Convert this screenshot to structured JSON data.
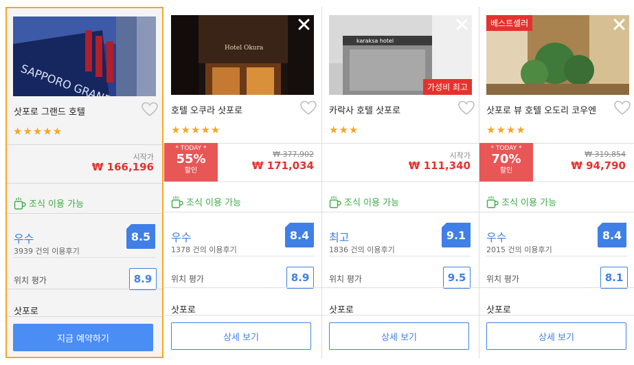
{
  "colors": {
    "accent": "#3f7fe6",
    "price": "#e5322d",
    "discount_bg": "#e85656",
    "breakfast": "#3cab46",
    "star": "#f5a623",
    "selected_border": "#f5a623"
  },
  "hotels": [
    {
      "name": "삿포로 그랜드 호텔",
      "stars": "★★★★★",
      "price_from_label": "시작가",
      "price": "₩ 166,196",
      "breakfast": "조식 이용 가능",
      "rating_word": "우수",
      "reviews": "3939 건의 이용후기",
      "score": "8.5",
      "location_label": "위치 평가",
      "location_score": "8.9",
      "city": "삿포로",
      "button": "지금 예약하기"
    },
    {
      "name": "호텔 오쿠라 삿포로",
      "stars": "★★★★★",
      "discount_today": "* TODAY *",
      "discount_pct": "55%",
      "discount_label": "할인",
      "original_price": "₩ 377,902",
      "price": "₩ 171,034",
      "breakfast": "조식 이용 가능",
      "rating_word": "우수",
      "reviews": "1378 건의 이용후기",
      "score": "8.4",
      "location_label": "위치 평가",
      "location_score": "8.9",
      "city": "삿포로",
      "button": "상세 보기"
    },
    {
      "name": "카락사 호텔 삿포로",
      "stars": "★★★",
      "badge": "가성비 최고",
      "price_from_label": "시작가",
      "price": "₩ 111,340",
      "breakfast": "조식 이용 가능",
      "rating_word": "최고",
      "reviews": "1836 건의 이용후기",
      "score": "9.1",
      "location_label": "위치 평가",
      "location_score": "9.5",
      "city": "삿포로",
      "button": "상세 보기"
    },
    {
      "name": "삿포로 뷰 호텔 오도리 코우엔",
      "stars": "★★★★",
      "badge": "베스트셀러",
      "discount_today": "* TODAY *",
      "discount_pct": "70%",
      "discount_label": "할인",
      "original_price": "₩ 319,854",
      "price": "₩ 94,790",
      "breakfast": "조식 이용 가능",
      "rating_word": "우수",
      "reviews": "2015 건의 이용후기",
      "score": "8.4",
      "location_label": "위치 평가",
      "location_score": "8.1",
      "city": "삿포로",
      "button": "상세 보기"
    }
  ]
}
